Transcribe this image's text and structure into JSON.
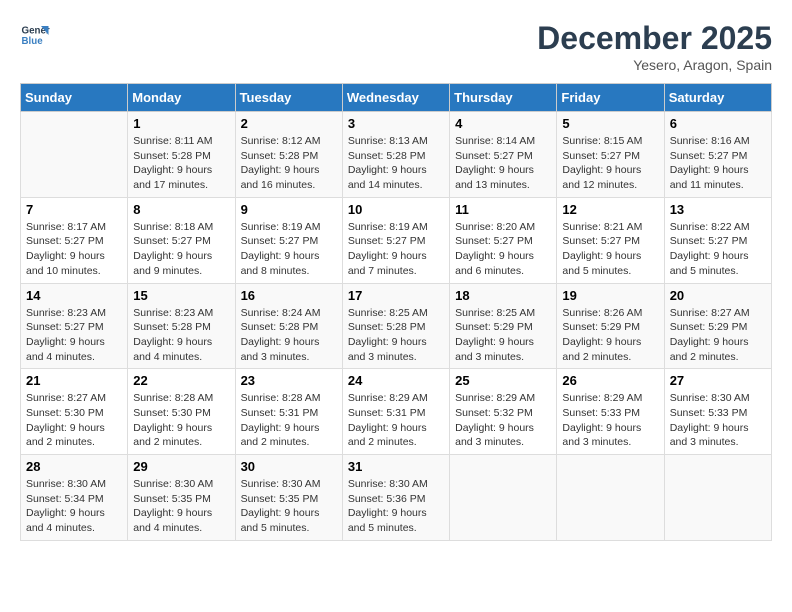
{
  "logo": {
    "line1": "General",
    "line2": "Blue"
  },
  "title": "December 2025",
  "location": "Yesero, Aragon, Spain",
  "days_of_week": [
    "Sunday",
    "Monday",
    "Tuesday",
    "Wednesday",
    "Thursday",
    "Friday",
    "Saturday"
  ],
  "weeks": [
    [
      {
        "day": "",
        "info": ""
      },
      {
        "day": "1",
        "info": "Sunrise: 8:11 AM\nSunset: 5:28 PM\nDaylight: 9 hours\nand 17 minutes."
      },
      {
        "day": "2",
        "info": "Sunrise: 8:12 AM\nSunset: 5:28 PM\nDaylight: 9 hours\nand 16 minutes."
      },
      {
        "day": "3",
        "info": "Sunrise: 8:13 AM\nSunset: 5:28 PM\nDaylight: 9 hours\nand 14 minutes."
      },
      {
        "day": "4",
        "info": "Sunrise: 8:14 AM\nSunset: 5:27 PM\nDaylight: 9 hours\nand 13 minutes."
      },
      {
        "day": "5",
        "info": "Sunrise: 8:15 AM\nSunset: 5:27 PM\nDaylight: 9 hours\nand 12 minutes."
      },
      {
        "day": "6",
        "info": "Sunrise: 8:16 AM\nSunset: 5:27 PM\nDaylight: 9 hours\nand 11 minutes."
      }
    ],
    [
      {
        "day": "7",
        "info": "Sunrise: 8:17 AM\nSunset: 5:27 PM\nDaylight: 9 hours\nand 10 minutes."
      },
      {
        "day": "8",
        "info": "Sunrise: 8:18 AM\nSunset: 5:27 PM\nDaylight: 9 hours\nand 9 minutes."
      },
      {
        "day": "9",
        "info": "Sunrise: 8:19 AM\nSunset: 5:27 PM\nDaylight: 9 hours\nand 8 minutes."
      },
      {
        "day": "10",
        "info": "Sunrise: 8:19 AM\nSunset: 5:27 PM\nDaylight: 9 hours\nand 7 minutes."
      },
      {
        "day": "11",
        "info": "Sunrise: 8:20 AM\nSunset: 5:27 PM\nDaylight: 9 hours\nand 6 minutes."
      },
      {
        "day": "12",
        "info": "Sunrise: 8:21 AM\nSunset: 5:27 PM\nDaylight: 9 hours\nand 5 minutes."
      },
      {
        "day": "13",
        "info": "Sunrise: 8:22 AM\nSunset: 5:27 PM\nDaylight: 9 hours\nand 5 minutes."
      }
    ],
    [
      {
        "day": "14",
        "info": "Sunrise: 8:23 AM\nSunset: 5:27 PM\nDaylight: 9 hours\nand 4 minutes."
      },
      {
        "day": "15",
        "info": "Sunrise: 8:23 AM\nSunset: 5:28 PM\nDaylight: 9 hours\nand 4 minutes."
      },
      {
        "day": "16",
        "info": "Sunrise: 8:24 AM\nSunset: 5:28 PM\nDaylight: 9 hours\nand 3 minutes."
      },
      {
        "day": "17",
        "info": "Sunrise: 8:25 AM\nSunset: 5:28 PM\nDaylight: 9 hours\nand 3 minutes."
      },
      {
        "day": "18",
        "info": "Sunrise: 8:25 AM\nSunset: 5:29 PM\nDaylight: 9 hours\nand 3 minutes."
      },
      {
        "day": "19",
        "info": "Sunrise: 8:26 AM\nSunset: 5:29 PM\nDaylight: 9 hours\nand 2 minutes."
      },
      {
        "day": "20",
        "info": "Sunrise: 8:27 AM\nSunset: 5:29 PM\nDaylight: 9 hours\nand 2 minutes."
      }
    ],
    [
      {
        "day": "21",
        "info": "Sunrise: 8:27 AM\nSunset: 5:30 PM\nDaylight: 9 hours\nand 2 minutes."
      },
      {
        "day": "22",
        "info": "Sunrise: 8:28 AM\nSunset: 5:30 PM\nDaylight: 9 hours\nand 2 minutes."
      },
      {
        "day": "23",
        "info": "Sunrise: 8:28 AM\nSunset: 5:31 PM\nDaylight: 9 hours\nand 2 minutes."
      },
      {
        "day": "24",
        "info": "Sunrise: 8:29 AM\nSunset: 5:31 PM\nDaylight: 9 hours\nand 2 minutes."
      },
      {
        "day": "25",
        "info": "Sunrise: 8:29 AM\nSunset: 5:32 PM\nDaylight: 9 hours\nand 3 minutes."
      },
      {
        "day": "26",
        "info": "Sunrise: 8:29 AM\nSunset: 5:33 PM\nDaylight: 9 hours\nand 3 minutes."
      },
      {
        "day": "27",
        "info": "Sunrise: 8:30 AM\nSunset: 5:33 PM\nDaylight: 9 hours\nand 3 minutes."
      }
    ],
    [
      {
        "day": "28",
        "info": "Sunrise: 8:30 AM\nSunset: 5:34 PM\nDaylight: 9 hours\nand 4 minutes."
      },
      {
        "day": "29",
        "info": "Sunrise: 8:30 AM\nSunset: 5:35 PM\nDaylight: 9 hours\nand 4 minutes."
      },
      {
        "day": "30",
        "info": "Sunrise: 8:30 AM\nSunset: 5:35 PM\nDaylight: 9 hours\nand 5 minutes."
      },
      {
        "day": "31",
        "info": "Sunrise: 8:30 AM\nSunset: 5:36 PM\nDaylight: 9 hours\nand 5 minutes."
      },
      {
        "day": "",
        "info": ""
      },
      {
        "day": "",
        "info": ""
      },
      {
        "day": "",
        "info": ""
      }
    ]
  ]
}
